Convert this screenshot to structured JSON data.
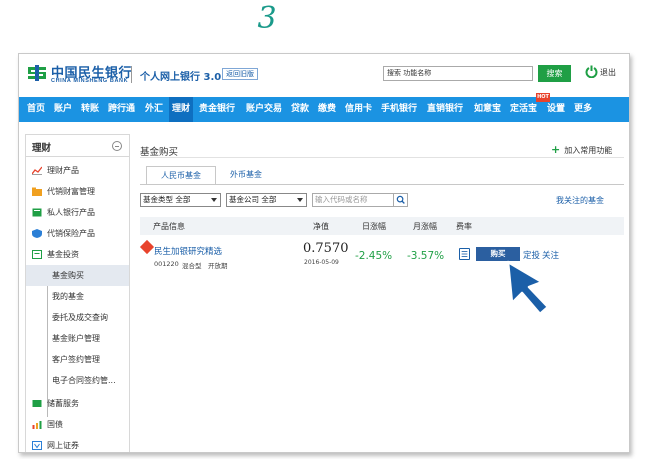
{
  "step_number": "3",
  "header": {
    "bank_name_cn": "中国民生银行",
    "bank_name_en": "CHINA MINSHENG BANK",
    "system_title": "个人网上银行 3.0",
    "old_version_label": "返回旧版",
    "search_placeholder": "搜索 功能名称",
    "search_button": "搜索",
    "logout_label": "退出"
  },
  "nav": {
    "items": [
      "首页",
      "账户",
      "转账",
      "跨行通",
      "外汇",
      "理财",
      "贵金银行",
      "账户交易",
      "贷款",
      "缴费",
      "信用卡",
      "手机银行",
      "直销银行",
      "如意宝",
      "定活宝",
      "设置",
      "更多"
    ],
    "active": "理财",
    "hot_badge": "HOT"
  },
  "sidebar": {
    "title": "理财",
    "items": [
      {
        "label": "理财产品",
        "icon": "chart-icon"
      },
      {
        "label": "代销财富管理",
        "icon": "folder-icon"
      },
      {
        "label": "私人银行产品",
        "icon": "book-icon"
      },
      {
        "label": "代销保险产品",
        "icon": "shield-icon"
      },
      {
        "label": "基金投资",
        "icon": "fund-icon"
      }
    ],
    "sub_items": [
      "基金购买",
      "我的基金",
      "委托及成交查询",
      "基金账户管理",
      "客户签约管理",
      "电子合同签约管..."
    ],
    "active_sub": "基金购买",
    "bottom_items": [
      {
        "label": "储蓄服务",
        "icon": "savings-icon"
      },
      {
        "label": "国债",
        "icon": "bond-icon"
      },
      {
        "label": "网上证券",
        "icon": "securities-icon"
      }
    ]
  },
  "main": {
    "title": "基金购买",
    "add_favorite": "加入常用功能",
    "tabs": [
      "人民币基金",
      "外币基金"
    ],
    "active_tab": "人民币基金",
    "filters": {
      "fund_type": "基金类型 全部",
      "fund_company": "基金公司 全部",
      "code_placeholder": "输入代码或名称"
    },
    "my_followed": "我关注的基金",
    "table": {
      "headers": [
        "产品信息",
        "净值",
        "日涨幅",
        "月涨幅",
        "费率"
      ],
      "rows": [
        {
          "badge": "HOT",
          "name": "民生加银研究精选",
          "code": "001220",
          "type": "混合型",
          "status": "开放期",
          "nav_value": "0.7570",
          "nav_date": "2016-05-09",
          "daily_change": "-2.45%",
          "monthly_change": "-3.57%",
          "buy_label": "购买",
          "dingtou_label": "定投",
          "follow_label": "关注"
        }
      ]
    }
  },
  "colors": {
    "brand_blue": "#1b5fa8",
    "nav_blue": "#1b93e2",
    "green": "#1f9f45",
    "hot_red": "#e8432c"
  }
}
